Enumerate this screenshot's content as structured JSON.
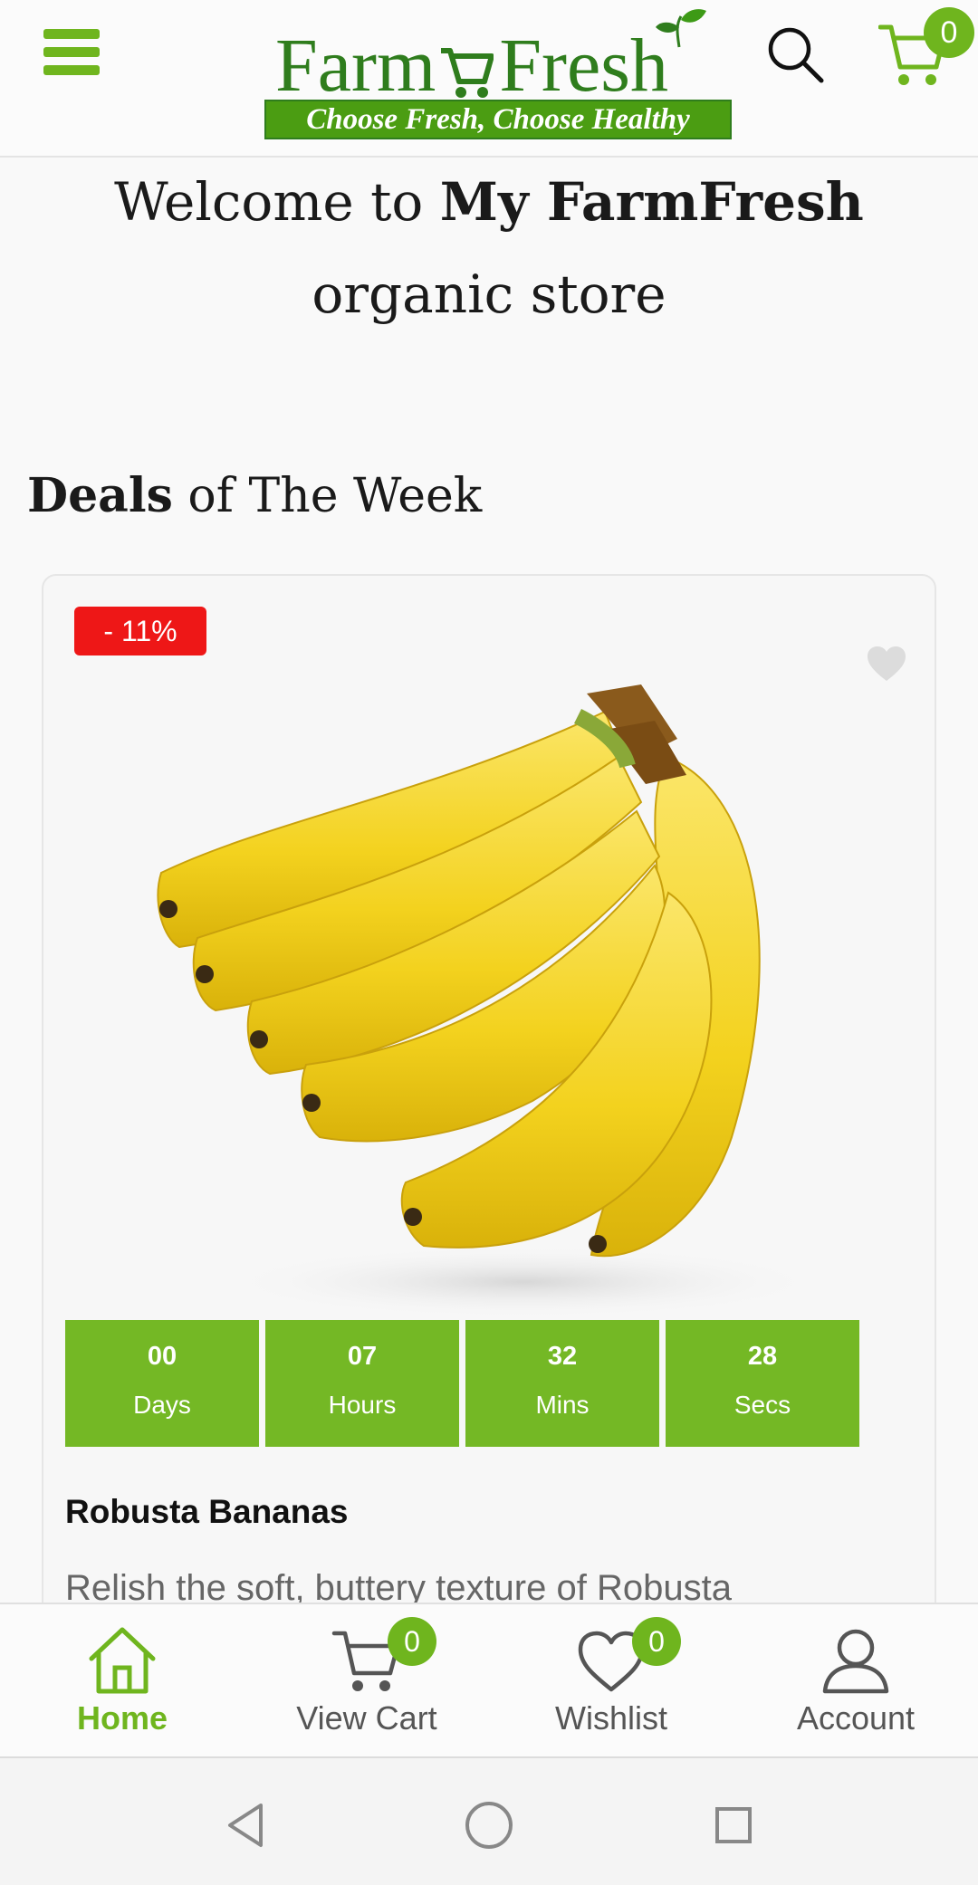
{
  "header": {
    "logo_word1": "Farm",
    "logo_word2": "Fresh",
    "logo_tagline": "Choose Fresh, Choose Healthy",
    "cart_count": "0",
    "icons": {
      "menu": "hamburger-icon",
      "search": "search-icon",
      "cart": "cart-icon"
    }
  },
  "welcome": {
    "prefix": "Welcome to ",
    "brand": "My FarmFresh",
    "suffix": " organic store"
  },
  "deals": {
    "title_bold": "Deals",
    "title_rest": " of The Week"
  },
  "product": {
    "discount": "- 11%",
    "name": "Robusta Bananas",
    "description": "Relish the soft, buttery texture of Robusta",
    "countdown": [
      {
        "value": "00",
        "label": "Days"
      },
      {
        "value": "07",
        "label": "Hours"
      },
      {
        "value": "32",
        "label": "Mins"
      },
      {
        "value": "28",
        "label": "Secs"
      }
    ]
  },
  "bottom_nav": [
    {
      "label": "Home",
      "icon": "home-icon",
      "active": true
    },
    {
      "label": "View Cart",
      "icon": "cart-icon",
      "badge": "0"
    },
    {
      "label": "Wishlist",
      "icon": "heart-icon",
      "badge": "0"
    },
    {
      "label": "Account",
      "icon": "user-icon"
    }
  ],
  "colors": {
    "brand_green": "#6fb51e",
    "logo_dark_green": "#2f7d1d",
    "discount_red": "#ee1717",
    "timer_green": "#74b825"
  }
}
